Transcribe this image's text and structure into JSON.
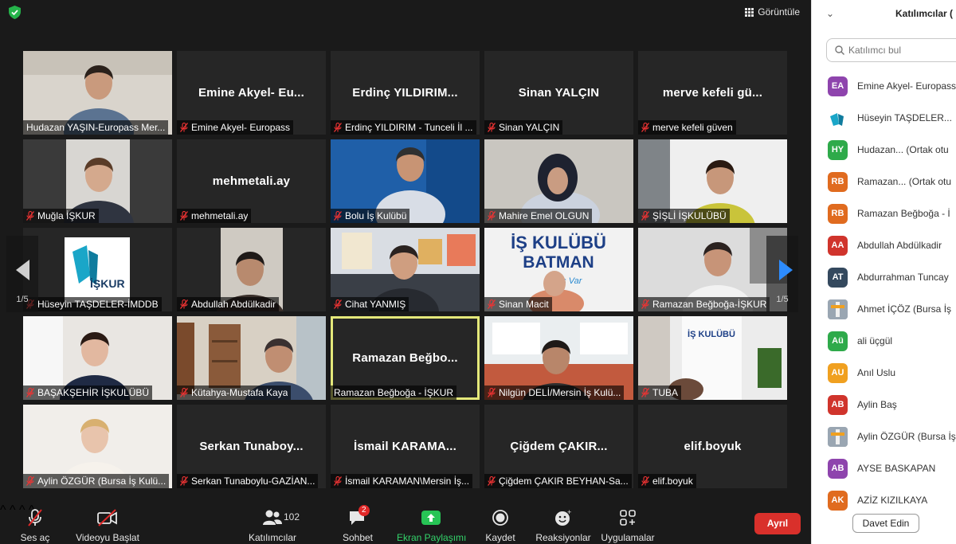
{
  "header": {
    "view_label": "Görüntüle"
  },
  "tiles": [
    {
      "label": "Hudazan YAŞIN-Europass Mer...",
      "name": "",
      "muted": false,
      "video": true,
      "scene": "man"
    },
    {
      "label": "Emine Akyel- Europass",
      "name": "Emine Akyel- Eu...",
      "muted": true,
      "video": false
    },
    {
      "label": "Erdinç YILDIRIM - Tunceli İl ...",
      "name": "Erdinç YILDIRIM...",
      "muted": true,
      "video": false
    },
    {
      "label": "Sinan YALÇIN",
      "name": "Sinan YALÇIN",
      "muted": true,
      "video": false
    },
    {
      "label": "merve kefeli güven",
      "name": "merve kefeli gü...",
      "muted": true,
      "video": false
    },
    {
      "label": "Muğla İŞKUR",
      "name": "",
      "muted": true,
      "video": true,
      "scene": "woman"
    },
    {
      "label": "mehmetali.ay",
      "name": "mehmetali.ay",
      "muted": true,
      "video": false
    },
    {
      "label": "Bolu İş Kulübü",
      "name": "",
      "muted": true,
      "video": true,
      "scene": "blue-man"
    },
    {
      "label": "Mahire Emel OLGUN",
      "name": "",
      "muted": true,
      "video": true,
      "scene": "hijab"
    },
    {
      "label": "ŞİŞLİ İŞKULÜBÜ",
      "name": "",
      "muted": true,
      "video": true,
      "scene": "woman2"
    },
    {
      "label": "Hüseyin TAŞDELER-İMDDB",
      "name": "",
      "muted": true,
      "video": true,
      "scene": "logo"
    },
    {
      "label": "Abdullah Abdülkadir",
      "name": "",
      "muted": true,
      "video": true,
      "scene": "man2"
    },
    {
      "label": "Cihat YANMIŞ",
      "name": "",
      "muted": true,
      "video": true,
      "scene": "office"
    },
    {
      "label": "Sinan Macit",
      "name": "",
      "muted": true,
      "video": true,
      "scene": "batman"
    },
    {
      "label": "Ramazan Beğboğa-İŞKUR",
      "name": "",
      "muted": true,
      "video": true,
      "scene": "man3"
    },
    {
      "label": "BAŞAKŞEHİR İŞKULÜBÜ",
      "name": "",
      "muted": true,
      "video": true,
      "scene": "woman3"
    },
    {
      "label": "Kütahya-Mustafa Kaya",
      "name": "",
      "muted": true,
      "video": true,
      "scene": "shelf"
    },
    {
      "label": "Ramazan Beğboğa - İŞKUR",
      "name": "Ramazan Beğbo...",
      "muted": false,
      "video": false,
      "active": true
    },
    {
      "label": "Nilgün DELİ/Mersin İş Kulü...",
      "name": "",
      "muted": true,
      "video": true,
      "scene": "woman4"
    },
    {
      "label": "TUBA",
      "name": "",
      "muted": true,
      "video": true,
      "scene": "tuba"
    },
    {
      "label": "Aylin ÖZGÜR (Bursa İş Kulü...",
      "name": "",
      "muted": true,
      "video": true,
      "scene": "blonde"
    },
    {
      "label": "Serkan Tunaboylu-GAZİAN...",
      "name": "Serkan Tunaboy...",
      "muted": true,
      "video": false
    },
    {
      "label": "İsmail KARAMAN\\Mersin İş...",
      "name": "İsmail KARAMA...",
      "muted": true,
      "video": false
    },
    {
      "label": "Çiğdem ÇAKIR BEYHAN-Sa...",
      "name": "Çiğdem ÇAKIR...",
      "muted": true,
      "video": false
    },
    {
      "label": "elif.boyuk",
      "name": "elif.boyuk",
      "muted": true,
      "video": false
    }
  ],
  "scene_text": {
    "logo_text": "İŞKUR",
    "batman_line1": "İŞ KULÜBÜ",
    "batman_line2": "BATMAN",
    "batman_line3": "Bu İş Var",
    "tuba_text": "İŞ KULÜBÜ"
  },
  "pager": {
    "left": "1/5",
    "right": "1/5"
  },
  "toolbar": {
    "mic_label": "Ses aç",
    "video_label": "Videoyu Başlat",
    "participants_label": "Katılımcılar",
    "participants_count": "102",
    "chat_label": "Sohbet",
    "chat_badge": "2",
    "share_label": "Ekran Paylaşımı",
    "record_label": "Kaydet",
    "reactions_label": "Reaksiyonlar",
    "apps_label": "Uygulamalar",
    "leave_label": "Ayrıl"
  },
  "panel": {
    "title": "Katılımcılar (",
    "search_placeholder": "Katılımcı bul",
    "invite_label": "Davet Edin",
    "participants": [
      {
        "initials": "EA",
        "name": "Emine Akyel- Europass",
        "color": "#8e44ad"
      },
      {
        "initials": "",
        "name": "Hüseyin TAŞDELER...",
        "color": "#3aa0d6",
        "image": "logo"
      },
      {
        "initials": "HY",
        "name": "Hudazan... (Ortak otu",
        "color": "#2eaa4a"
      },
      {
        "initials": "RB",
        "name": "Ramazan... (Ortak otu",
        "color": "#e06b1f"
      },
      {
        "initials": "RB",
        "name": "Ramazan Beğboğa - İ",
        "color": "#e06b1f"
      },
      {
        "initials": "AA",
        "name": "Abdullah Abdülkadir",
        "color": "#d0342c"
      },
      {
        "initials": "AT",
        "name": "Abdurrahman Tuncay",
        "color": "#34495e"
      },
      {
        "initials": "",
        "name": "Ahmet İÇÖZ (Bursa İş",
        "color": "#9aa6b2",
        "image": "tile"
      },
      {
        "initials": "Aü",
        "name": "ali üçgül",
        "color": "#2eaa4a"
      },
      {
        "initials": "AU",
        "name": "Anıl Uslu",
        "color": "#f0a020"
      },
      {
        "initials": "AB",
        "name": "Aylin Baş",
        "color": "#d0342c"
      },
      {
        "initials": "",
        "name": "Aylin ÖZGÜR (Bursa İş",
        "color": "#9aa6b2",
        "image": "tile"
      },
      {
        "initials": "AB",
        "name": "AYSE BASKAPAN",
        "color": "#8e44ad"
      },
      {
        "initials": "AK",
        "name": "AZİZ KIZILKAYA",
        "color": "#e06b1f"
      }
    ]
  }
}
